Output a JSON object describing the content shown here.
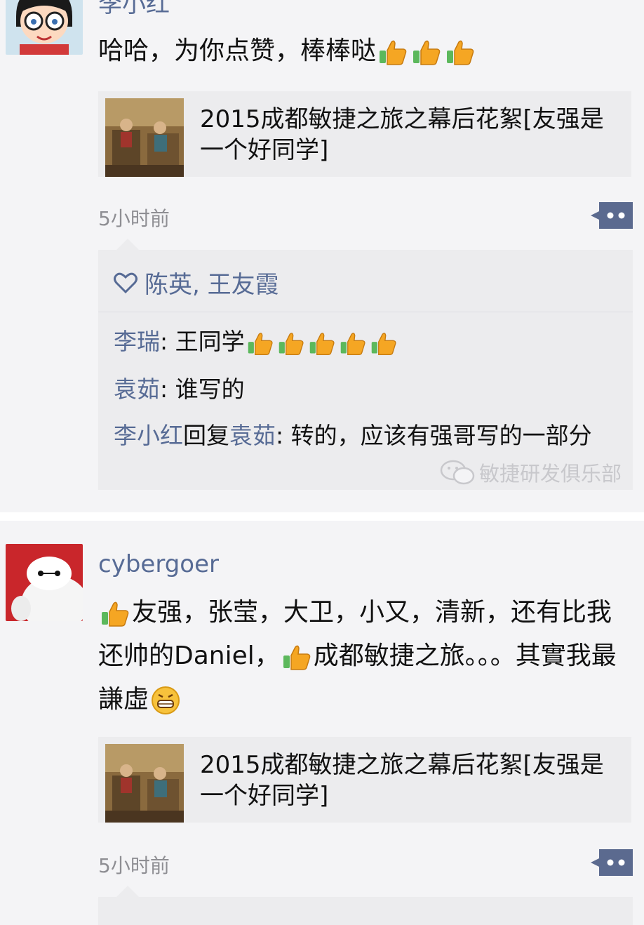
{
  "post1": {
    "author": "李小红",
    "text": "哈哈，为你点赞，棒棒哒",
    "link_title": "2015成都敏捷之旅之幕后花絮[友强是一个好同学]",
    "time": "5小时前",
    "likes": "陈英, 王友霞",
    "comments": [
      {
        "author": "李瑞",
        "sep": ": ",
        "text": "王同学"
      },
      {
        "author": "袁茹",
        "sep": ": ",
        "text": "谁写的"
      },
      {
        "author": "李小红",
        "reply_word": "回复",
        "reply_to": "袁茹",
        "sep": ": ",
        "text": "转的，应该有强哥写的一部分"
      }
    ],
    "watermark": "敏捷研发俱乐部"
  },
  "post2": {
    "author": "cybergoer",
    "text_part1": "友强，张莹，大卫，小又，清新，还有比我还帅的Daniel，",
    "text_part2": "成都敏捷之旅。。。其實我最謙虛",
    "link_title": "2015成都敏捷之旅之幕后花絮[友强是一个好同学]",
    "time": "5小时前"
  },
  "colors": {
    "name_blue": "#576b95",
    "background": "#f4f4f6",
    "card_bg": "#ececee",
    "time_gray": "#8e8e93"
  },
  "icons": [
    "thumbs-up-icon",
    "heart-icon",
    "more-comment-icon",
    "wechat-icon",
    "grin-icon"
  ]
}
